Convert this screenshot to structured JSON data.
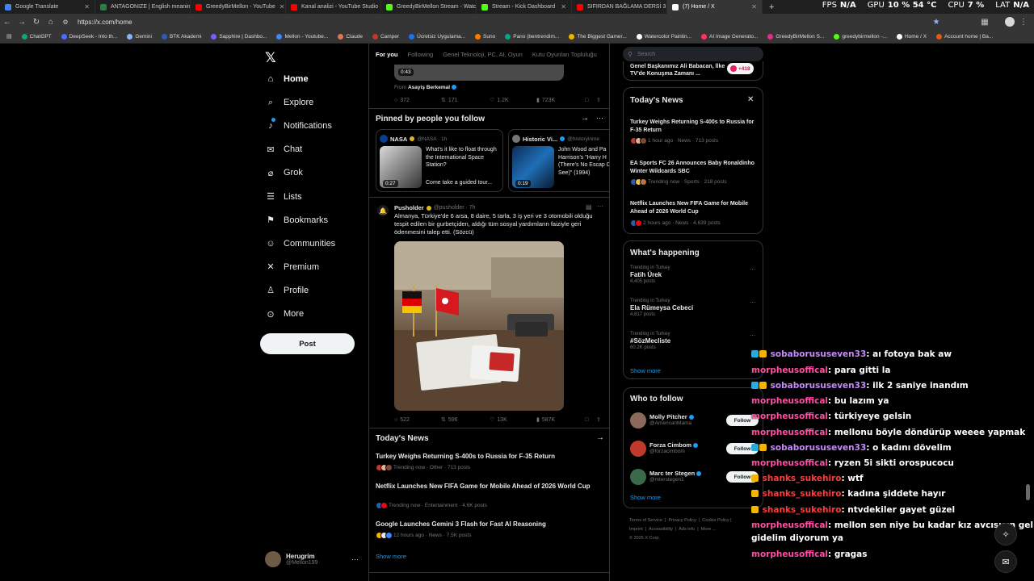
{
  "browser": {
    "tabs": [
      {
        "title": "Google Translate",
        "color": "#4285f4",
        "active": false
      },
      {
        "title": "ANTAGONIZE | English meaning -",
        "color": "#2d7d46",
        "active": false
      },
      {
        "title": "GreedyBirMellon - YouTube",
        "color": "#ff0000",
        "active": false
      },
      {
        "title": "Kanal analizi - YouTube Studio",
        "color": "#ff0000",
        "active": false
      },
      {
        "title": "GreedyBirMellon Stream - Watch",
        "color": "#53fc18",
        "active": false
      },
      {
        "title": "Stream - Kick Dashboard",
        "color": "#53fc18",
        "active": false
      },
      {
        "title": "SIFIRDAN BAĞLAMA DERSİ 3 (EN",
        "color": "#ff0000",
        "active": false
      },
      {
        "title": "(7) Home / X",
        "color": "#ffffff",
        "active": true
      }
    ],
    "url": "https://x.com/home",
    "bookmarks": [
      "ChatGPT",
      "DeepSeek - Into th...",
      "Gemini",
      "BTK Akademi",
      "Sapphire | Dashbo...",
      "Mellon - Youtube...",
      "Claude",
      "Camper",
      "Ücretsiz Uygulama...",
      "Suno",
      "Pano (bentrendim...",
      "The Biggest Gamer...",
      "Watercolor Paintin...",
      "AI Image Generato...",
      "GreedyBirMellon S...",
      "greedybirmellon -...",
      "Home / X",
      "Account home | Ba..."
    ],
    "bookmark_colors": [
      "#10a37f",
      "#4d6bfe",
      "#8ab4f8",
      "#2d5fa8",
      "#7b5cff",
      "#4285f4",
      "#d97757",
      "#c0392b",
      "#1a73e8",
      "#ff7a00",
      "#00a884",
      "#e6b800",
      "#ffffff",
      "#ff3366",
      "#d63384",
      "#53fc18",
      "#ffffff",
      "#e8590c"
    ]
  },
  "stats": {
    "fps_label": "FPS",
    "fps": "N/A",
    "gpu_label": "GPU",
    "gpu": "10 % 54 °C",
    "cpu_label": "CPU",
    "cpu": "7 %",
    "lat_label": "LAT",
    "lat": "N/A"
  },
  "nav": {
    "items": [
      {
        "label": "Home",
        "icon": "home-icon"
      },
      {
        "label": "Explore",
        "icon": "search-icon"
      },
      {
        "label": "Notifications",
        "icon": "bell-icon"
      },
      {
        "label": "Chat",
        "icon": "mail-icon"
      },
      {
        "label": "Grok",
        "icon": "grok-icon"
      },
      {
        "label": "Lists",
        "icon": "list-icon"
      },
      {
        "label": "Bookmarks",
        "icon": "bookmark-icon"
      },
      {
        "label": "Communities",
        "icon": "people-icon"
      },
      {
        "label": "Premium",
        "icon": "x-icon"
      },
      {
        "label": "Profile",
        "icon": "person-icon"
      },
      {
        "label": "More",
        "icon": "more-circle-icon"
      }
    ],
    "post_label": "Post",
    "account_name": "Herugrim",
    "account_handle": "@Mellon199"
  },
  "feed": {
    "tabs": [
      "For you",
      "Following",
      "Genel Teknoloji, PC, AI, Oyun",
      "Kutu Oyunları Topluluğu"
    ],
    "top_video_duration": "0:43",
    "from_label": "From",
    "from_name": "Asayiş Berkemal",
    "top_actions": {
      "replies": "372",
      "reposts": "171",
      "likes": "1.2K",
      "views": "723K"
    },
    "pinned_title": "Pinned by people you follow",
    "pinned": [
      {
        "name": "NASA",
        "handle": "@NASA · 1h",
        "duration": "0:27",
        "text": "What's it like to float through the International Space Station?",
        "text2": "Come take a guided tour..."
      },
      {
        "name": "Historic Vi...",
        "handle": "@historyinme",
        "duration": "0:19",
        "text": "John Wood and Pa Harrison's \"Harry H (There's No Escap Can See)\" (1994)"
      }
    ],
    "post": {
      "name": "Pusholder",
      "handle": "@pusholder · 7h",
      "text": "Almanya, Türkiye'de 6 arsa, 8 daire, 5 tarla, 3 iş yeri ve 3 otomobili olduğu tespit edilen bir gurbetçiden, aldığı tüm sosyal yardımların faiziyle geri ödenmesini talep etti. (Sözcü)",
      "replies": "522",
      "reposts": "596",
      "likes": "13K",
      "views": "587K"
    },
    "news_title": "Today's News",
    "news": [
      {
        "title": "Turkey Weighs Returning S-400s to Russia for F-35 Return",
        "meta": "Trending now · Other · 713 posts"
      },
      {
        "title": "Netflix Launches New FIFA Game for Mobile Ahead of 2026 World Cup",
        "meta": "Trending now · Entertainment · 4.6K posts"
      },
      {
        "title": "Google Launches Gemini 3 Flash for Fast AI Reasoning",
        "meta": "12 hours ago · News · 7.5K posts"
      }
    ],
    "show_more": "Show more"
  },
  "right": {
    "search_placeholder": "Search",
    "top_item_text": "Genel Başkanımız Ali Babacan, İlke TV'de Konuşma Zamanı ...",
    "top_item_count": "+418",
    "todays_news_title": "Today's News",
    "todays_news": [
      {
        "title": "Turkey Weighs Returning S-400s to Russia for F-35 Return",
        "meta": "1 hour ago · News · 713 posts"
      },
      {
        "title": "EA Sports FC 26 Announces Baby Ronaldinho Winter Wildcards SBC",
        "meta": "Trending now · Sports · 218 posts"
      },
      {
        "title": "Netflix Launches New FIFA Game for Mobile Ahead of 2026 World Cup",
        "meta": "2 hours ago · News · 4,639 posts"
      }
    ],
    "happening_title": "What's happening",
    "trends": [
      {
        "context": "Trending in Turkey",
        "name": "Fatih Ürek",
        "count": "4,405 posts"
      },
      {
        "context": "Trending in Turkey",
        "name": "Ela Rümeysa Cebeci",
        "count": "4,817 posts"
      },
      {
        "context": "Trending in Turkey",
        "name": "#SözMecliste",
        "count": "60.2K posts"
      }
    ],
    "show_more": "Show more",
    "who_title": "Who to follow",
    "who": [
      {
        "name": "Molly Pitcher",
        "handle": "@AmericanMama",
        "color": "#8a6a5a"
      },
      {
        "name": "Forza Cimbom",
        "handle": "@forzacimbom",
        "color": "#c0392b"
      },
      {
        "name": "Marc ter Stegen",
        "handle": "@mterstegen1",
        "color": "#3a6a4a"
      }
    ],
    "follow_label": "Follow",
    "footer": [
      "Terms of Service",
      "Privacy Policy",
      "Cookie Policy",
      "Imprint",
      "Accessibility",
      "Ads info",
      "More ...",
      "© 2025 X Corp."
    ]
  },
  "chat": {
    "lines": [
      {
        "user": "sobaborususeven33",
        "msg": ": aı fotoya bak aw",
        "color": "#c58af9",
        "badges": 2
      },
      {
        "user": "morpheusoffical",
        "msg": ": para gitti la",
        "color": "#ff4fa3",
        "badges": 0
      },
      {
        "user": "sobaborususeven33",
        "msg": ": ilk 2 saniye inandım",
        "color": "#c58af9",
        "badges": 2
      },
      {
        "user": "morpheusoffical",
        "msg": ": bu lazım ya",
        "color": "#ff4fa3",
        "badges": 0
      },
      {
        "user": "morpheusoffical",
        "msg": ": türkiyeye gelsin",
        "color": "#ff4fa3",
        "badges": 0
      },
      {
        "user": "morpheusoffical",
        "msg": ": mellonu böyle döndürüp weeee yapmak",
        "color": "#ff4fa3",
        "badges": 0
      },
      {
        "user": "sobaborususeven33",
        "msg": ": o kadını dövelim",
        "color": "#c58af9",
        "badges": 2
      },
      {
        "user": "morpheusoffical",
        "msg": ": ryzen 5i sikti orospucocu",
        "color": "#ff4fa3",
        "badges": 0
      },
      {
        "user": "shanks_sukehiro",
        "msg": ": wtf",
        "color": "#ff3b3b",
        "badges": 1
      },
      {
        "user": "shanks_sukehiro",
        "msg": ": kadına şiddete hayır",
        "color": "#ff3b3b",
        "badges": 1
      },
      {
        "user": "shanks_sukehiro",
        "msg": ": ntvdekiler gayet güzel",
        "color": "#ff3b3b",
        "badges": 1
      },
      {
        "user": "morpheusoffical",
        "msg": ": mellon sen niye bu kadar kız avcısısın gel estonyaya",
        "color": "#ff4fa3",
        "badges": 0
      },
      {
        "user": "",
        "msg": "gidelim diyorum ya",
        "color": "#ff4fa3",
        "badges": 0
      },
      {
        "user": "morpheusoffical",
        "msg": ": gragas",
        "color": "#ff4fa3",
        "badges": 0
      }
    ]
  }
}
